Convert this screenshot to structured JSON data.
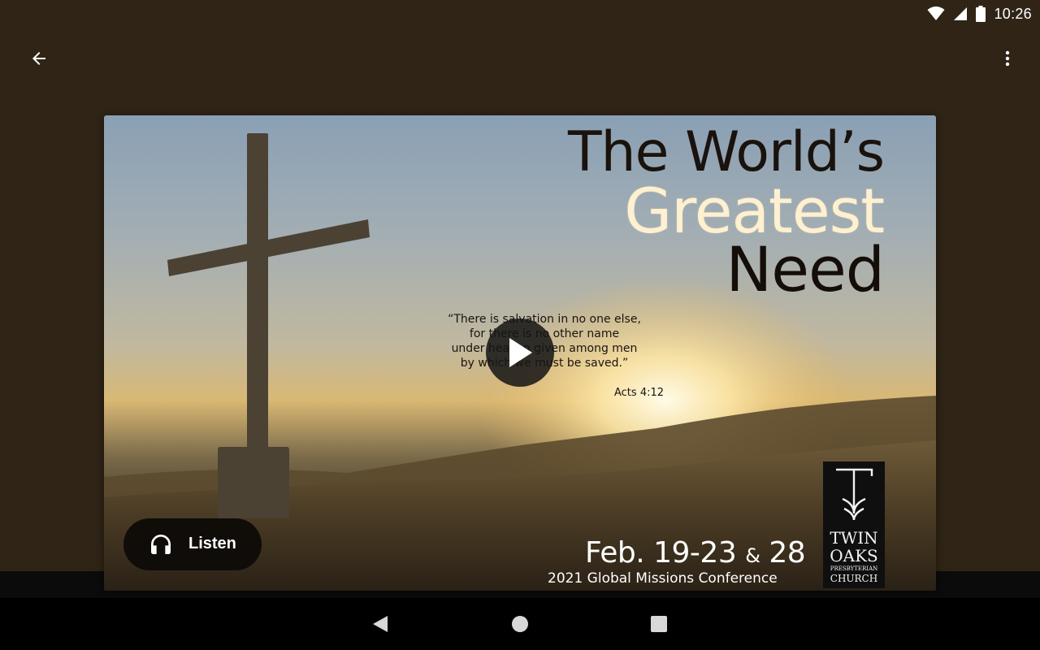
{
  "status_bar": {
    "time": "10:26"
  },
  "app_bar": {
    "back_icon": "arrow-left-icon",
    "more_icon": "more-vert-icon"
  },
  "media": {
    "headline": [
      "The World’s",
      "Greatest",
      "Need"
    ],
    "quote_lines": [
      "“There is salvation in no one else,",
      "for there is no other name",
      "under heaven given among men",
      "by which we must be saved.”"
    ],
    "reference": "Acts 4:12",
    "dates_part1": "Feb. 19-23",
    "dates_amp": "&",
    "dates_part2": "28",
    "conference": "2021 Global Missions Conference",
    "logo": {
      "line1": "TWIN",
      "line2": "OAKS",
      "line3": "PRESBYTERIAN",
      "line4": "CHURCH"
    }
  },
  "controls": {
    "play_icon": "play-icon",
    "listen_label": "Listen",
    "listen_icon": "headphones-icon"
  },
  "nav_bar": {
    "back": "nav-back-icon",
    "home": "nav-home-icon",
    "recents": "nav-recents-icon"
  },
  "colors": {
    "background": "#2f2416",
    "headline_gold": "#fff0d0"
  }
}
